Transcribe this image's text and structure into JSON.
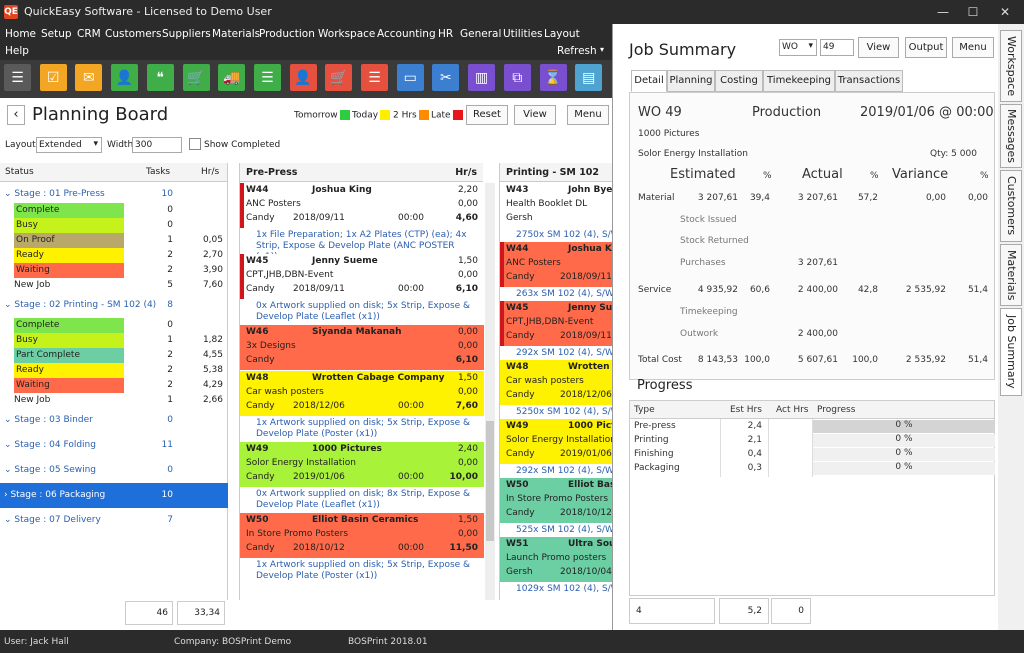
{
  "window": {
    "title": "QuickEasy Software - Licensed to Demo User",
    "logo": "QE",
    "min": "—",
    "max": "☐",
    "close": "✕"
  },
  "menu": [
    "Home",
    "Setup",
    "CRM",
    "Customers",
    "Suppliers",
    "Materials",
    "Production",
    "Workspace",
    "Accounting",
    "HR",
    "General",
    "Utilities",
    "Layout"
  ],
  "menu2": {
    "help": "Help",
    "refresh": "Refresh"
  },
  "toolbar_icons": [
    {
      "name": "hamburger-icon",
      "color": "#5a5a5a",
      "glyph": "☰"
    },
    {
      "name": "calendar-check-icon",
      "color": "#f2a623",
      "glyph": "☑"
    },
    {
      "name": "mail-icon",
      "color": "#f2a623",
      "glyph": "✉"
    },
    {
      "name": "user-icon",
      "color": "#3fae49",
      "glyph": "👤"
    },
    {
      "name": "chat-icon",
      "color": "#3fae49",
      "glyph": "❝"
    },
    {
      "name": "cart-add-icon",
      "color": "#3fae49",
      "glyph": "🛒"
    },
    {
      "name": "truck-icon",
      "color": "#3fae49",
      "glyph": "🚚"
    },
    {
      "name": "document-icon",
      "color": "#3fae49",
      "glyph": "☰"
    },
    {
      "name": "person-icon",
      "color": "#e5503f",
      "glyph": "👤"
    },
    {
      "name": "cart-icon",
      "color": "#e5503f",
      "glyph": "🛒"
    },
    {
      "name": "invoice-icon",
      "color": "#e5503f",
      "glyph": "☰"
    },
    {
      "name": "box-icon",
      "color": "#3c7fd1",
      "glyph": "▭"
    },
    {
      "name": "scissors-doc-icon",
      "color": "#3c7fd1",
      "glyph": "✂"
    },
    {
      "name": "factory-icon",
      "color": "#7a4fcf",
      "glyph": "▥"
    },
    {
      "name": "hierarchy-icon",
      "color": "#7a4fcf",
      "glyph": "⧉"
    },
    {
      "name": "hourglass-icon",
      "color": "#7a4fcf",
      "glyph": "⌛"
    },
    {
      "name": "book-icon",
      "color": "#4fa3d1",
      "glyph": "▤"
    }
  ],
  "planning": {
    "title": "Planning Board",
    "legend": {
      "tomorrow": "Tomorrow",
      "today": "Today",
      "two_hrs": "2 Hrs",
      "late": "Late"
    },
    "colors": {
      "tomorrow": "#2ecc40",
      "today": "#ffee00",
      "two_hrs": "#ff8c00",
      "late": "#e8161b"
    },
    "reset": "Reset",
    "view": "View",
    "menu": "Menu",
    "layout_label": "Layout",
    "layout_value": "Extended",
    "width_label": "Width",
    "width_value": "300",
    "show_completed": "Show Completed",
    "status_headers": [
      "Status",
      "Tasks",
      "Hr/s"
    ],
    "status_rows": [
      {
        "label": "Stage : 01 Pre-Press",
        "tasks": "10",
        "hrs": "",
        "stage": true
      },
      {
        "label": "Complete",
        "tasks": "0",
        "hrs": "",
        "color": "#7fe54c"
      },
      {
        "label": "Busy",
        "tasks": "0",
        "hrs": "",
        "color": "#c6f21c"
      },
      {
        "label": "On Proof",
        "tasks": "1",
        "hrs": "0,05",
        "color": "#b8a86a"
      },
      {
        "label": "Ready",
        "tasks": "2",
        "hrs": "2,70",
        "color": "#fff200"
      },
      {
        "label": "Waiting",
        "tasks": "2",
        "hrs": "3,90",
        "color": "#ff6b4a"
      },
      {
        "label": "New Job",
        "tasks": "5",
        "hrs": "7,60",
        "color": ""
      },
      {
        "label": "Stage : 02 Printing - SM 102 (4)",
        "tasks": "8",
        "hrs": "",
        "stage": true
      },
      {
        "label": "Complete",
        "tasks": "0",
        "hrs": "",
        "color": "#7fe54c"
      },
      {
        "label": "Busy",
        "tasks": "1",
        "hrs": "1,82",
        "color": "#c6f21c"
      },
      {
        "label": "Part Complete",
        "tasks": "2",
        "hrs": "4,55",
        "color": "#6ccfa4"
      },
      {
        "label": "Ready",
        "tasks": "2",
        "hrs": "5,38",
        "color": "#fff200"
      },
      {
        "label": "Waiting",
        "tasks": "2",
        "hrs": "4,29",
        "color": "#ff6b4a"
      },
      {
        "label": "New Job",
        "tasks": "1",
        "hrs": "2,66",
        "color": ""
      },
      {
        "label": "Stage : 03 Binder",
        "tasks": "0",
        "hrs": "",
        "stage": true
      },
      {
        "label": "Stage : 04 Folding",
        "tasks": "11",
        "hrs": "",
        "stage": true
      },
      {
        "label": "Stage : 05 Sewing",
        "tasks": "0",
        "hrs": "",
        "stage": true
      },
      {
        "label": "Stage : 06 Packaging",
        "tasks": "10",
        "hrs": "",
        "stage": true,
        "selected": true
      },
      {
        "label": "Stage : 07 Delivery",
        "tasks": "7",
        "hrs": "",
        "stage": true
      }
    ],
    "status_totals": {
      "tasks": "46",
      "hrs": "33,34"
    },
    "prepress": {
      "header": "Pre-Press",
      "hrs_header": "Hr/s",
      "jobs": [
        {
          "wo": "W44",
          "name": "Joshua King",
          "hrs": "2,20",
          "desc": "ANC Posters",
          "val": "0,00",
          "client": "Candy",
          "date": "2018/09/11",
          "time": "00:00",
          "total": "4,60",
          "color": "#ffffff",
          "redbar": true,
          "tasks": "1x File Preparation; 1x A2 Plates (CTP) (ea); 4x Strip, Expose & Develop Plate (ANC POSTER (x1))"
        },
        {
          "wo": "W45",
          "name": "Jenny Sueme",
          "hrs": "1,50",
          "desc": "CPT,JHB,DBN-Event",
          "val": "0,00",
          "client": "Candy",
          "date": "2018/09/11",
          "time": "00:00",
          "total": "6,10",
          "color": "#ffffff",
          "redbar": true,
          "tasks": "0x Artwork supplied on disk; 5x Strip, Expose & Develop Plate (Leaflet (x1))"
        },
        {
          "wo": "W46",
          "name": "Siyanda Makanah",
          "hrs": "0,00",
          "desc": "3x Designs",
          "val": "0,00",
          "client": "Candy",
          "date": "",
          "time": "",
          "total": "6,10",
          "color": "#ff6b4a",
          "redbar": false,
          "tasks": "3x Artwork supplied on disk"
        },
        {
          "wo": "W48",
          "name": "Wrotten Cabage Company",
          "hrs": "1,50",
          "desc": "Car wash posters",
          "val": "0,00",
          "client": "Candy",
          "date": "2018/12/06",
          "time": "00:00",
          "total": "7,60",
          "color": "#fff200",
          "redbar": false,
          "tasks": "1x Artwork supplied on disk; 5x Strip, Expose & Develop Plate (Poster (x1))"
        },
        {
          "wo": "W49",
          "name": "1000 Pictures",
          "hrs": "2,40",
          "desc": "Solor Energy Installation",
          "val": "0,00",
          "client": "Candy",
          "date": "2019/01/06",
          "time": "00:00",
          "total": "10,00",
          "color": "#a8f23a",
          "redbar": false,
          "tasks": "0x Artwork supplied on disk; 8x Strip, Expose & Develop Plate (Leaflet (x1))"
        },
        {
          "wo": "W50",
          "name": "Elliot Basin Ceramics",
          "hrs": "1,50",
          "desc": "In Store Promo Posters",
          "val": "0,00",
          "client": "Candy",
          "date": "2018/10/12",
          "time": "00:00",
          "total": "11,50",
          "color": "#ff6b4a",
          "redbar": false,
          "tasks": "1x Artwork supplied on disk; 5x Strip, Expose & Develop Plate (Poster (x1))"
        }
      ]
    },
    "printing": {
      "header": "Printing - SM 102 (4)",
      "jobs": [
        {
          "wo": "W43",
          "name": "John Bye",
          "desc": "Health Booklet DL",
          "client": "Gersh",
          "date": "",
          "color": "#ffffff",
          "tasks": "2750x SM 102 (4), S/W"
        },
        {
          "wo": "W44",
          "name": "Joshua K",
          "desc": "ANC Posters",
          "client": "Candy",
          "date": "2018/09/11",
          "color": "#ff6b4a",
          "tasks": "263x SM 102 (4), S/W"
        },
        {
          "wo": "W45",
          "name": "Jenny Su",
          "desc": "CPT,JHB,DBN-Event",
          "client": "Candy",
          "date": "2018/09/11",
          "color": "#ff6b4a",
          "tasks": "292x SM 102 (4), S/W"
        },
        {
          "wo": "W48",
          "name": "Wrotten",
          "desc": "Car wash posters",
          "client": "Candy",
          "date": "2018/12/06",
          "color": "#fff200",
          "tasks": "5250x SM 102 (4), S/W"
        },
        {
          "wo": "W49",
          "name": "1000 Pict",
          "desc": "Solor Energy Installation",
          "client": "Candy",
          "date": "2019/01/06",
          "color": "#fff200",
          "tasks": "292x SM 102 (4), S/W"
        },
        {
          "wo": "W50",
          "name": "Elliot Basi",
          "desc": "In Store Promo Posters",
          "client": "Candy",
          "date": "2018/10/12",
          "color": "#6ccfa4",
          "tasks": "525x SM 102 (4), S/W"
        },
        {
          "wo": "W51",
          "name": "Ultra Sou",
          "desc": "Launch Promo posters",
          "client": "Gersh",
          "date": "2018/10/04",
          "color": "#6ccfa4",
          "tasks": "1029x SM 102 (4), S/W"
        }
      ]
    }
  },
  "summary": {
    "title": "Job Summary",
    "wo_select": "WO",
    "wo_number": "49",
    "view": "View",
    "output": "Output",
    "menu": "Menu",
    "tabs": [
      "Detail",
      "Planning",
      "Costing",
      "Timekeeping",
      "Transactions"
    ],
    "wo": "WO 49",
    "dept": "Production",
    "datetime": "2019/01/06 @ 00:00",
    "client": "1000 Pictures",
    "job": "Solor Energy Installation",
    "qty": "Qty: 5 000",
    "headers": {
      "estimated": "Estimated",
      "pct": "%",
      "actual": "Actual",
      "variance": "Variance"
    },
    "rows": [
      {
        "label": "Material",
        "est": "3 207,61",
        "ep": "39,4",
        "act": "3 207,61",
        "ap": "57,2",
        "var": "0,00",
        "vp": "0,00"
      },
      {
        "label": "Stock Issued",
        "est": "",
        "ep": "",
        "act": "",
        "ap": "",
        "var": "",
        "vp": "",
        "sub": true
      },
      {
        "label": "Stock Returned",
        "est": "",
        "ep": "",
        "act": "",
        "ap": "",
        "var": "",
        "vp": "",
        "sub": true
      },
      {
        "label": "Purchases",
        "est": "",
        "ep": "",
        "act": "3 207,61",
        "ap": "",
        "var": "",
        "vp": "",
        "sub": true
      },
      {
        "label": "Service",
        "est": "4 935,92",
        "ep": "60,6",
        "act": "2 400,00",
        "ap": "42,8",
        "var": "2 535,92",
        "vp": "51,4"
      },
      {
        "label": "Timekeeping",
        "est": "",
        "ep": "",
        "act": "",
        "ap": "",
        "var": "",
        "vp": "",
        "sub": true
      },
      {
        "label": "Outwork",
        "est": "",
        "ep": "",
        "act": "2 400,00",
        "ap": "",
        "var": "",
        "vp": "",
        "sub": true
      },
      {
        "label": "Total Cost",
        "est": "8 143,53",
        "ep": "100,0",
        "act": "5 607,61",
        "ap": "100,0",
        "var": "2 535,92",
        "vp": "51,4"
      }
    ],
    "progress_title": "Progress",
    "progress_headers": [
      "Type",
      "Est Hrs",
      "Act Hrs",
      "Progress"
    ],
    "progress_rows": [
      {
        "type": "Pre-press",
        "est": "2,4",
        "act": "",
        "pct": "0 %"
      },
      {
        "type": "Printing",
        "est": "2,1",
        "act": "",
        "pct": "0 %"
      },
      {
        "type": "Finishing",
        "est": "0,4",
        "act": "",
        "pct": "0 %"
      },
      {
        "type": "Packaging",
        "est": "0,3",
        "act": "",
        "pct": "0 %"
      }
    ],
    "progress_totals": {
      "count": "4",
      "est": "5,2",
      "act": "0"
    }
  },
  "side_tabs": [
    "Workspace",
    "Messages",
    "Customers",
    "Materials",
    "Job Summary"
  ],
  "statusbar": {
    "user": "User: Jack Hall",
    "company": "Company: BOSPrint Demo",
    "version": "BOSPrint 2018.01"
  }
}
